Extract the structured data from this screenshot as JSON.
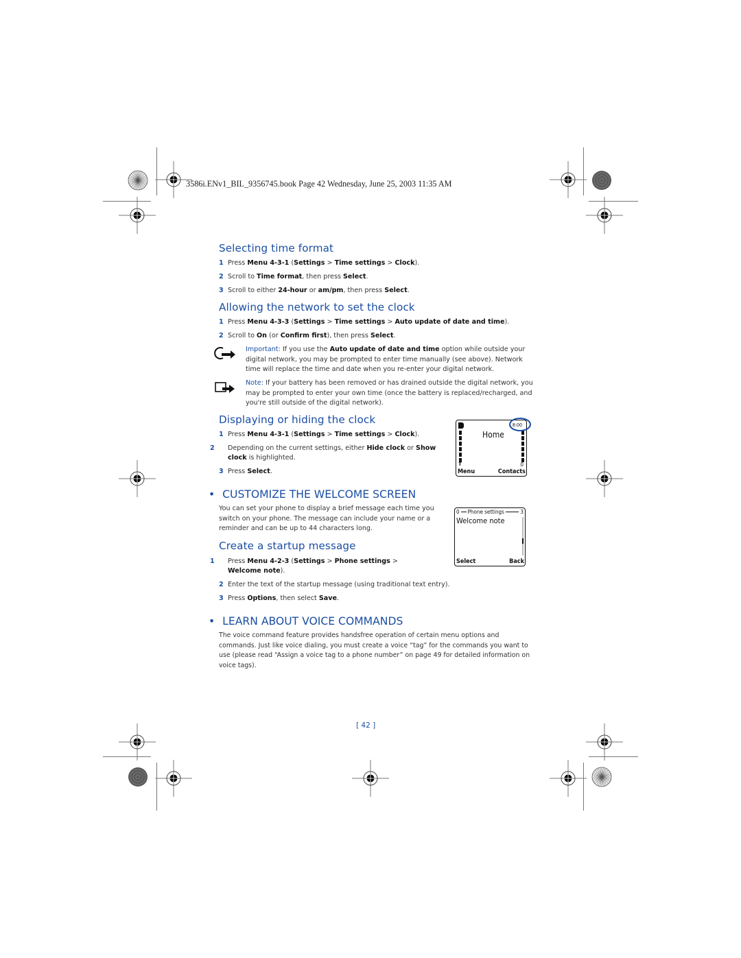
{
  "header": {
    "print_line": "3586i.ENv1_BIL_9356745.book  Page 42  Wednesday, June 25, 2003  11:35 AM"
  },
  "sections": {
    "selecting_time_format": {
      "title": "Selecting time format",
      "steps": [
        {
          "num": "1",
          "parts": [
            [
              "Press ",
              false
            ],
            [
              "Menu 4-3-1",
              true
            ],
            [
              " (",
              false
            ],
            [
              "Settings",
              true
            ],
            [
              " > ",
              false
            ],
            [
              "Time settings",
              true
            ],
            [
              " > ",
              false
            ],
            [
              "Clock",
              true
            ],
            [
              ").",
              false
            ]
          ]
        },
        {
          "num": "2",
          "parts": [
            [
              "Scroll to ",
              false
            ],
            [
              "Time format",
              true
            ],
            [
              ", then press ",
              false
            ],
            [
              "Select",
              true
            ],
            [
              ".",
              false
            ]
          ]
        },
        {
          "num": "3",
          "parts": [
            [
              "Scroll to either ",
              false
            ],
            [
              "24-hour",
              true
            ],
            [
              " or ",
              false
            ],
            [
              "am/pm",
              true
            ],
            [
              ", then press ",
              false
            ],
            [
              "Select",
              true
            ],
            [
              ".",
              false
            ]
          ]
        }
      ]
    },
    "network_clock": {
      "title": "Allowing the network to set the clock",
      "steps": [
        {
          "num": "1",
          "parts": [
            [
              "Press ",
              false
            ],
            [
              "Menu 4-3-3",
              true
            ],
            [
              " (",
              false
            ],
            [
              "Settings",
              true
            ],
            [
              " > ",
              false
            ],
            [
              "Time settings",
              true
            ],
            [
              " > ",
              false
            ],
            [
              "Auto update of date and time",
              true
            ],
            [
              ").",
              false
            ]
          ]
        },
        {
          "num": "2",
          "parts": [
            [
              "Scroll to ",
              false
            ],
            [
              "On",
              true
            ],
            [
              " (or ",
              false
            ],
            [
              "Confirm first",
              true
            ],
            [
              "), then press ",
              false
            ],
            [
              "Select",
              true
            ],
            [
              ".",
              false
            ]
          ]
        }
      ],
      "important": {
        "label": "Important:",
        "parts": [
          [
            " If you use the ",
            false
          ],
          [
            "Auto update of date and time",
            true
          ],
          [
            " option while outside your digital network, you may be prompted to enter time manually (see above). Network time will replace the time and date when you re-enter your digital network.",
            false
          ]
        ]
      },
      "note": {
        "label": "Note:",
        "text": " If your battery has been removed or has drained outside the digital network, you may be prompted to enter your own time (once the battery is replaced/recharged, and you're still outside of the digital network)."
      }
    },
    "display_clock": {
      "title": "Displaying or hiding the clock",
      "steps": [
        {
          "num": "1",
          "parts": [
            [
              "Press ",
              false
            ],
            [
              "Menu 4-3-1",
              true
            ],
            [
              " (",
              false
            ],
            [
              "Settings",
              true
            ],
            [
              " > ",
              false
            ],
            [
              "Time settings",
              true
            ],
            [
              " > ",
              false
            ],
            [
              "Clock",
              true
            ],
            [
              ").",
              false
            ]
          ]
        },
        {
          "num": "2",
          "parts": [
            [
              "Depending on the current settings, either ",
              false
            ],
            [
              "Hide clock",
              true
            ],
            [
              " or ",
              false
            ],
            [
              "Show clock",
              true
            ],
            [
              " is highlighted.",
              false
            ]
          ]
        },
        {
          "num": "3",
          "parts": [
            [
              "Press ",
              false
            ],
            [
              "Select",
              true
            ],
            [
              ".",
              false
            ]
          ]
        }
      ],
      "phone_screen": {
        "clock": "8:00",
        "title": "Home",
        "left_softkey": "Menu",
        "right_softkey": "Contacts",
        "battery_indicator": "0"
      }
    },
    "welcome_screen": {
      "bullet": "•",
      "title": "CUSTOMIZE THE WELCOME SCREEN",
      "body": "You can set your phone to display a brief message each time you switch on your phone. The message can include your name or a reminder and can be up to 44 characters long.",
      "phone_screen": {
        "left_num": "0",
        "header": "Phone settings",
        "right_num": "3",
        "item": "Welcome note",
        "left_softkey": "Select",
        "right_softkey": "Back"
      }
    },
    "startup_message": {
      "title": "Create a startup message",
      "steps": [
        {
          "num": "1",
          "parts": [
            [
              "Press ",
              false
            ],
            [
              "Menu 4-2-3",
              true
            ],
            [
              " (",
              false
            ],
            [
              "Settings",
              true
            ],
            [
              " > ",
              false
            ],
            [
              "Phone settings",
              true
            ],
            [
              " > ",
              false
            ],
            [
              "Welcome note",
              true
            ],
            [
              ").",
              false
            ]
          ]
        },
        {
          "num": "2",
          "parts": [
            [
              "Enter the text of the startup message (using traditional text entry).",
              false
            ]
          ]
        },
        {
          "num": "3",
          "parts": [
            [
              "Press ",
              false
            ],
            [
              "Options",
              true
            ],
            [
              ", then select ",
              false
            ],
            [
              "Save",
              true
            ],
            [
              ".",
              false
            ]
          ]
        }
      ]
    },
    "voice_commands": {
      "bullet": "•",
      "title": "LEARN ABOUT VOICE COMMANDS",
      "body": "The voice command feature provides handsfree operation of certain menu options and commands. Just like voice dialing, you must create a voice “tag” for the commands you want to use (please read “Assign a voice tag to a phone number” on page 49 for detailed information on voice tags)."
    }
  },
  "footer": {
    "page_number": "[ 42 ]"
  },
  "colors": {
    "heading_blue": "#1b4ea3",
    "body_text": "#333333"
  }
}
